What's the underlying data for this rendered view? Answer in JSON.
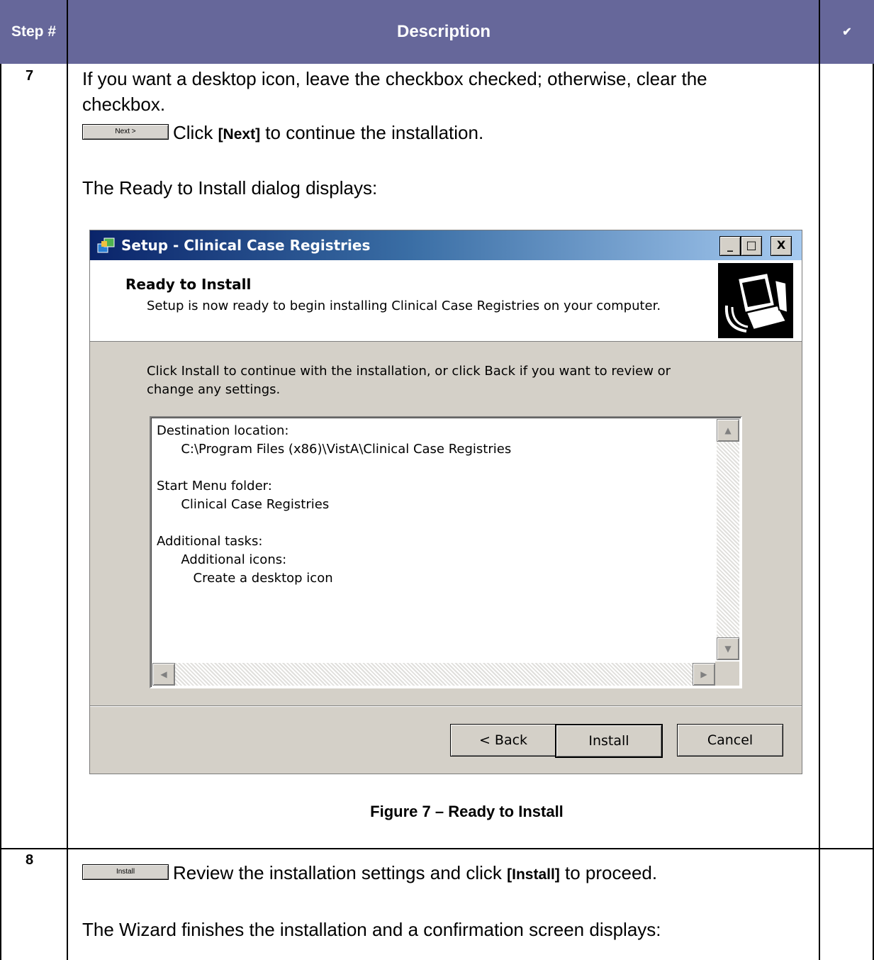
{
  "table": {
    "headers": {
      "step": "Step #",
      "description": "Description",
      "check": "✔"
    }
  },
  "rows": [
    {
      "step": "7",
      "line1": "If you want a desktop icon, leave the checkbox checked; otherwise, clear the",
      "line2": "checkbox.",
      "button_image_label": "Next >",
      "click_pre": "Click ",
      "click_bold": "[Next]",
      "click_post": " to continue the installation.",
      "dialog_intro": "The Ready to Install dialog displays:"
    },
    {
      "step": "8",
      "button_image_label": "Install",
      "review_pre": "Review the installation settings and click ",
      "review_bold": "[Install]",
      "review_post": " to proceed.",
      "finish_text": "The Wizard finishes the installation and a confirmation screen displays:"
    }
  ],
  "dialog": {
    "title": "Setup - Clinical Case Registries",
    "heading": "Ready to Install",
    "subheading": "Setup is now ready to begin installing Clinical Case Registries on your computer.",
    "instructions": "Click Install to continue with the installation, or click Back if you want to review or change any settings.",
    "memo_text": "Destination location:\n      C:\\Program Files (x86)\\VistA\\Clinical Case Registries\n\nStart Menu folder:\n      Clinical Case Registries\n\nAdditional tasks:\n      Additional icons:\n         Create a desktop icon",
    "buttons": {
      "back": "< Back",
      "install": "Install",
      "cancel": "Cancel"
    },
    "window_controls": {
      "minimize": "_",
      "maximize": "□",
      "close": "X"
    }
  },
  "figure_caption": "Figure 7 – Ready to Install"
}
